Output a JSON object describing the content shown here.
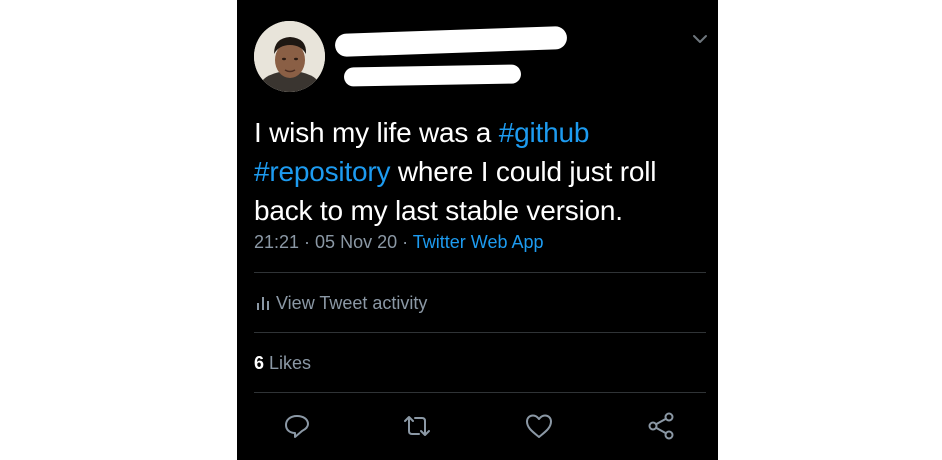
{
  "tweet": {
    "text_parts": {
      "p1": "I wish my life was a ",
      "hashtag1": "#github",
      "p2": " ",
      "hashtag2": "#repository",
      "p3": " where I could just roll back to my last stable version."
    },
    "time": "21:21",
    "date": "05 Nov 20",
    "source": "Twitter Web App",
    "separator": " · ",
    "activity_label": "View Tweet activity",
    "likes_count": "6",
    "likes_label": "Likes"
  },
  "colors": {
    "background": "#000000",
    "text": "#ffffff",
    "accent": "#1d9bf0",
    "muted": "#8b98a5",
    "divider": "#2f3336"
  },
  "icons": {
    "chevron": "chevron-down-icon",
    "activity": "bar-chart-icon",
    "reply": "reply-icon",
    "retweet": "retweet-icon",
    "like": "heart-icon",
    "share": "share-icon"
  }
}
